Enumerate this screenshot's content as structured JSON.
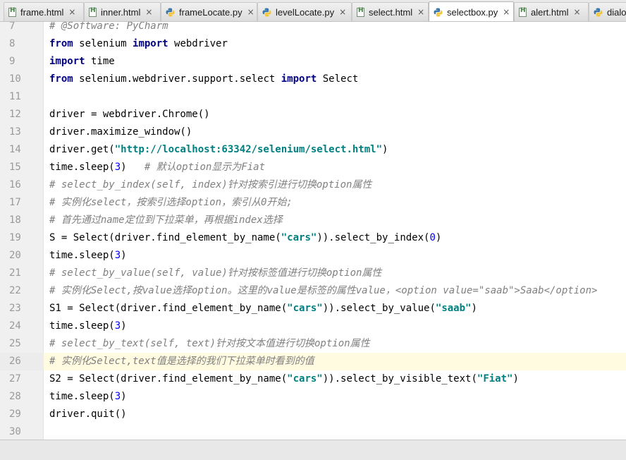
{
  "tabs": [
    {
      "label": "frame.html",
      "type": "html",
      "active": false
    },
    {
      "label": "inner.html",
      "type": "html",
      "active": false
    },
    {
      "label": "frameLocate.py",
      "type": "py",
      "active": false
    },
    {
      "label": "levelLocate.py",
      "type": "py",
      "active": false
    },
    {
      "label": "select.html",
      "type": "html",
      "active": false
    },
    {
      "label": "selectbox.py",
      "type": "py",
      "active": true
    },
    {
      "label": "alert.html",
      "type": "html",
      "active": false
    },
    {
      "label": "dialo",
      "type": "py",
      "active": false
    }
  ],
  "tab_close_glyph": "×",
  "current_line": 26,
  "lines": [
    {
      "n": "7",
      "tokens": [
        {
          "t": "com",
          "s": "# @Software: PyCharm"
        }
      ]
    },
    {
      "n": "8",
      "tokens": [
        {
          "t": "kw",
          "s": "from"
        },
        {
          "t": "",
          "s": " selenium "
        },
        {
          "t": "kw",
          "s": "import"
        },
        {
          "t": "",
          "s": " webdriver"
        }
      ]
    },
    {
      "n": "9",
      "tokens": [
        {
          "t": "kw",
          "s": "import"
        },
        {
          "t": "",
          "s": " time"
        }
      ]
    },
    {
      "n": "10",
      "tokens": [
        {
          "t": "kw",
          "s": "from"
        },
        {
          "t": "",
          "s": " selenium.webdriver.support.select "
        },
        {
          "t": "kw",
          "s": "import"
        },
        {
          "t": "",
          "s": " Select"
        }
      ]
    },
    {
      "n": "11",
      "tokens": []
    },
    {
      "n": "12",
      "tokens": [
        {
          "t": "",
          "s": "driver = webdriver.Chrome()"
        }
      ]
    },
    {
      "n": "13",
      "tokens": [
        {
          "t": "",
          "s": "driver.maximize_window()"
        }
      ]
    },
    {
      "n": "14",
      "tokens": [
        {
          "t": "",
          "s": "driver.get("
        },
        {
          "t": "str",
          "s": "\"http://localhost:63342/selenium/select.html\""
        },
        {
          "t": "",
          "s": ")"
        }
      ]
    },
    {
      "n": "15",
      "tokens": [
        {
          "t": "",
          "s": "time.sleep("
        },
        {
          "t": "num",
          "s": "3"
        },
        {
          "t": "",
          "s": ")   "
        },
        {
          "t": "com",
          "s": "# 默认option显示为Fiat"
        }
      ]
    },
    {
      "n": "16",
      "tokens": [
        {
          "t": "com",
          "s": "# select_by_index(self, index)针对按索引进行切换option属性"
        }
      ]
    },
    {
      "n": "17",
      "tokens": [
        {
          "t": "com",
          "s": "# 实例化select，按索引选择option，索引从0开始;"
        }
      ]
    },
    {
      "n": "18",
      "tokens": [
        {
          "t": "com",
          "s": "# 首先通过name定位到下拉菜单，再根据index选择"
        }
      ]
    },
    {
      "n": "19",
      "tokens": [
        {
          "t": "",
          "s": "S = Select(driver.find_element_by_name("
        },
        {
          "t": "str",
          "s": "\"cars\""
        },
        {
          "t": "",
          "s": ")).select_by_index("
        },
        {
          "t": "num",
          "s": "0"
        },
        {
          "t": "",
          "s": ")"
        }
      ]
    },
    {
      "n": "20",
      "tokens": [
        {
          "t": "",
          "s": "time.sleep("
        },
        {
          "t": "num",
          "s": "3"
        },
        {
          "t": "",
          "s": ")"
        }
      ]
    },
    {
      "n": "21",
      "tokens": [
        {
          "t": "com",
          "s": "# select_by_value(self, value)针对按标签值进行切换option属性"
        }
      ]
    },
    {
      "n": "22",
      "tokens": [
        {
          "t": "com",
          "s": "# 实例化Select,按value选择option。这里的value是标签的属性value，<option value=\"saab\">Saab</option>"
        }
      ]
    },
    {
      "n": "23",
      "tokens": [
        {
          "t": "",
          "s": "S1 = Select(driver.find_element_by_name("
        },
        {
          "t": "str",
          "s": "\"cars\""
        },
        {
          "t": "",
          "s": ")).select_by_value("
        },
        {
          "t": "str",
          "s": "\"saab\""
        },
        {
          "t": "",
          "s": ")"
        }
      ]
    },
    {
      "n": "24",
      "tokens": [
        {
          "t": "",
          "s": "time.sleep("
        },
        {
          "t": "num",
          "s": "3"
        },
        {
          "t": "",
          "s": ")"
        }
      ]
    },
    {
      "n": "25",
      "tokens": [
        {
          "t": "com",
          "s": "# select_by_text(self, text)针对按文本值进行切换option属性"
        }
      ]
    },
    {
      "n": "26",
      "tokens": [
        {
          "t": "com",
          "s": "# 实例化Select,text值是选择的我们下拉菜单时看到的值"
        }
      ]
    },
    {
      "n": "27",
      "tokens": [
        {
          "t": "",
          "s": "S2 = Select(driver.find_element_by_name("
        },
        {
          "t": "str",
          "s": "\"cars\""
        },
        {
          "t": "",
          "s": ")).select_by_visible_text("
        },
        {
          "t": "str",
          "s": "\"Fiat\""
        },
        {
          "t": "",
          "s": ")"
        }
      ]
    },
    {
      "n": "28",
      "tokens": [
        {
          "t": "",
          "s": "time.sleep("
        },
        {
          "t": "num",
          "s": "3"
        },
        {
          "t": "",
          "s": ")"
        }
      ]
    },
    {
      "n": "29",
      "tokens": [
        {
          "t": "",
          "s": "driver.quit()"
        }
      ]
    },
    {
      "n": "30",
      "tokens": []
    }
  ]
}
